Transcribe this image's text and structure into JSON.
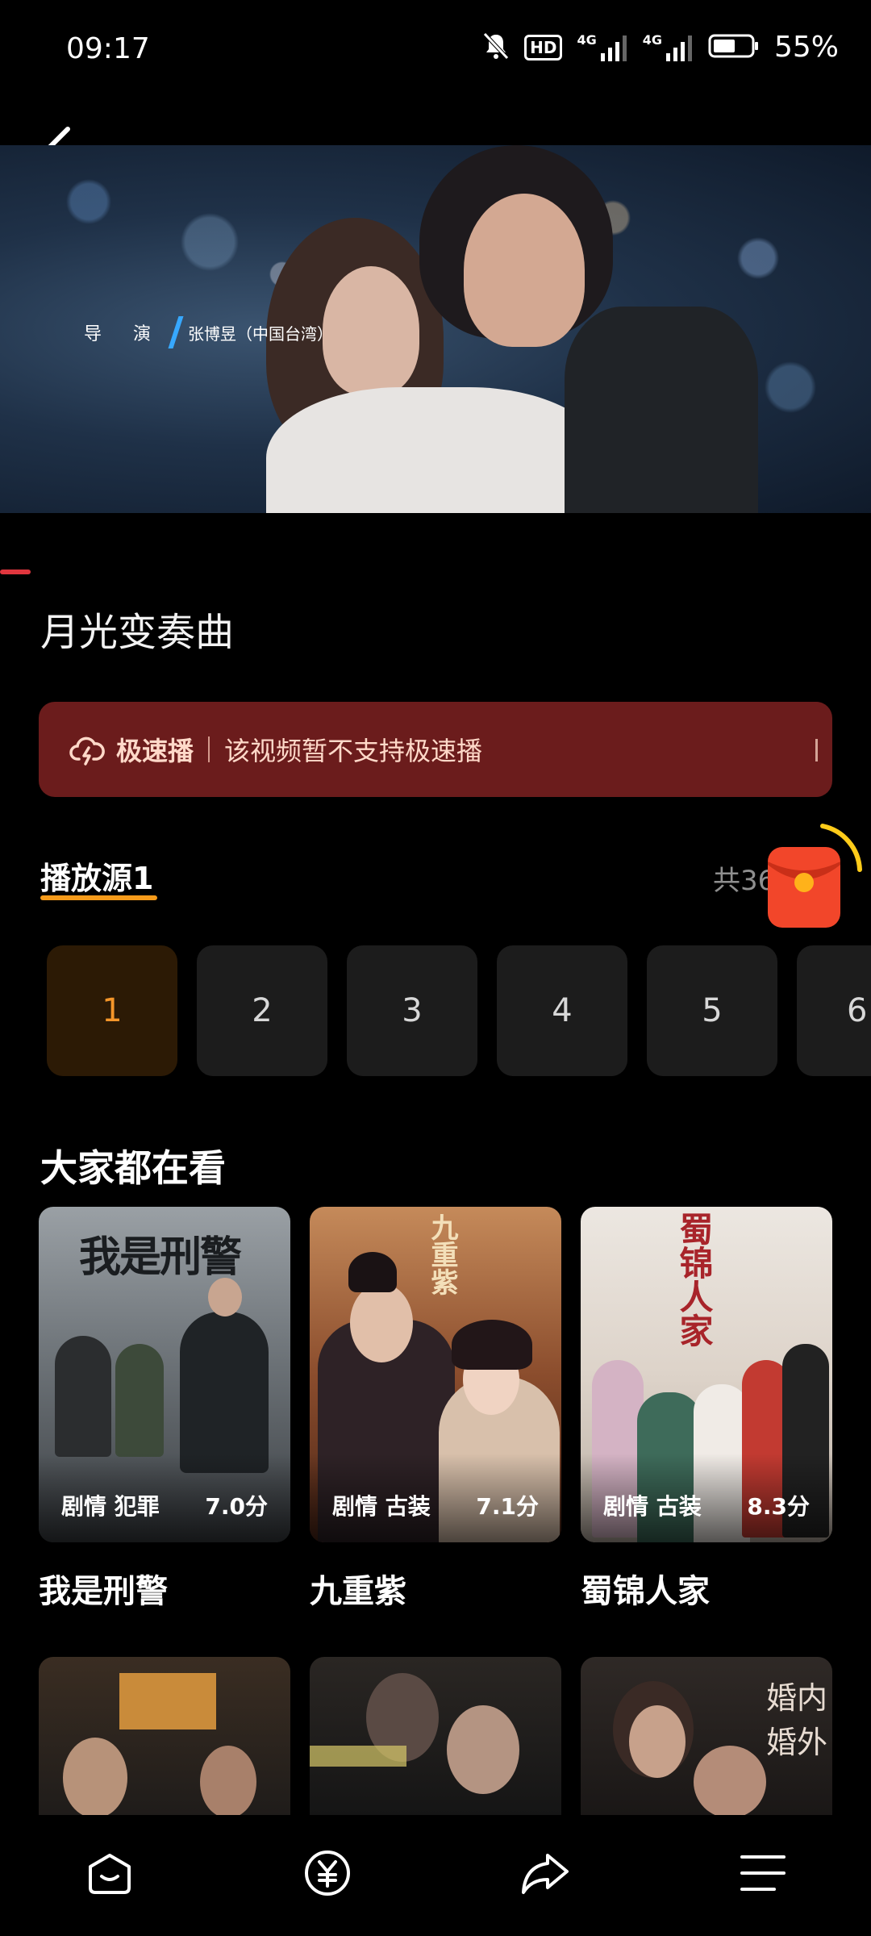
{
  "status_bar": {
    "time": "09:17",
    "battery_percent": "55%",
    "icons": [
      "mute-icon",
      "hd-icon",
      "signal-4g-icon",
      "signal-4g-icon",
      "battery-icon"
    ],
    "hd_label": "HD",
    "network_label": "4G"
  },
  "player": {
    "credit_role": "导 演",
    "credit_name": "张博昱（中国台湾）"
  },
  "video": {
    "title": "月光变奏曲"
  },
  "speed_banner": {
    "icon": "cloud-lightning-icon",
    "label": "极速播",
    "message": "该视频暂不支持极速播",
    "bg_color": "#6b1c1c"
  },
  "source": {
    "label": "播放源1",
    "total": "共36",
    "accent_color": "#f59a1a"
  },
  "episodes": {
    "items": [
      "1",
      "2",
      "3",
      "4",
      "5",
      "6"
    ],
    "selected": "1"
  },
  "recommend": {
    "title": "大家都在看",
    "items": [
      {
        "title": "我是刑警",
        "tags": "剧情 犯罪",
        "score": "7.0分",
        "poster_text": "我是刑警"
      },
      {
        "title": "九重紫",
        "tags": "剧情 古装",
        "score": "7.1分",
        "poster_text": "九重紫"
      },
      {
        "title": "蜀锦人家",
        "tags": "剧情 古装",
        "score": "8.3分",
        "poster_text": "蜀锦人家"
      }
    ],
    "row2_poster_texts": [
      "",
      "",
      "婚内婚外"
    ]
  },
  "bottom_nav": {
    "items": [
      "home-icon",
      "yuan-icon",
      "share-icon",
      "menu-icon"
    ]
  }
}
